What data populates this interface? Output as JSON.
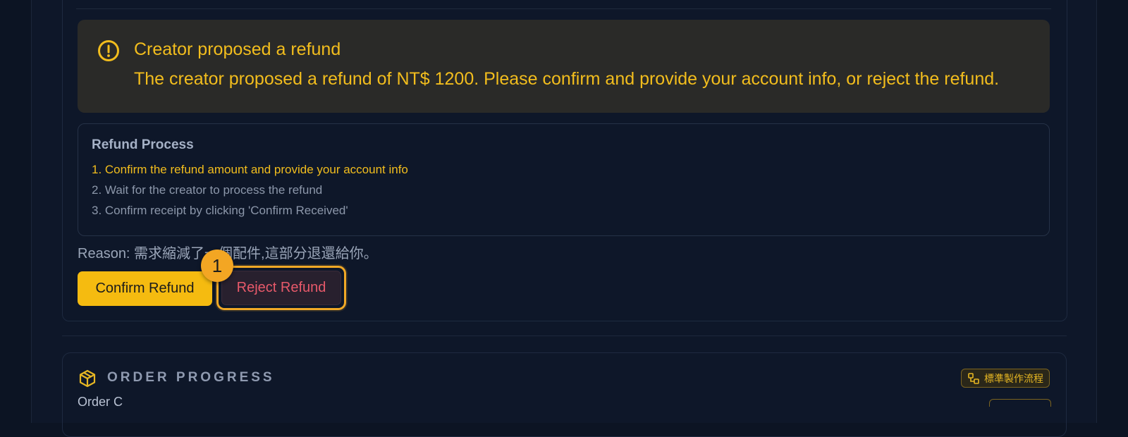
{
  "alert": {
    "icon": "alert-circle-icon",
    "title": "Creator proposed a refund",
    "body": "The creator proposed a refund of NT$ 1200. Please confirm and provide your account info, or reject the refund.",
    "color": "#f2bd1d"
  },
  "process": {
    "title": "Refund Process",
    "steps": [
      {
        "text": "1. Confirm the refund amount and provide your account info",
        "active": true
      },
      {
        "text": "2. Wait for the creator to process the refund",
        "active": false
      },
      {
        "text": "3. Confirm receipt by clicking 'Confirm Received'",
        "active": false
      }
    ]
  },
  "reason": {
    "text": "Reason: 需求縮減了一個配件,這部分退還給你。"
  },
  "actions": {
    "confirm_label": "Confirm Refund",
    "reject_label": "Reject Refund",
    "highlight_badge": "1",
    "confirm_color": "#f5bb10",
    "reject_color": "#e7596a"
  },
  "order_progress": {
    "icon": "package-icon",
    "title": "ORDER PROGRESS",
    "workflow_tag": {
      "icon": "workflow-icon",
      "label": "標準製作流程"
    },
    "first_row_label": "Order C"
  }
}
